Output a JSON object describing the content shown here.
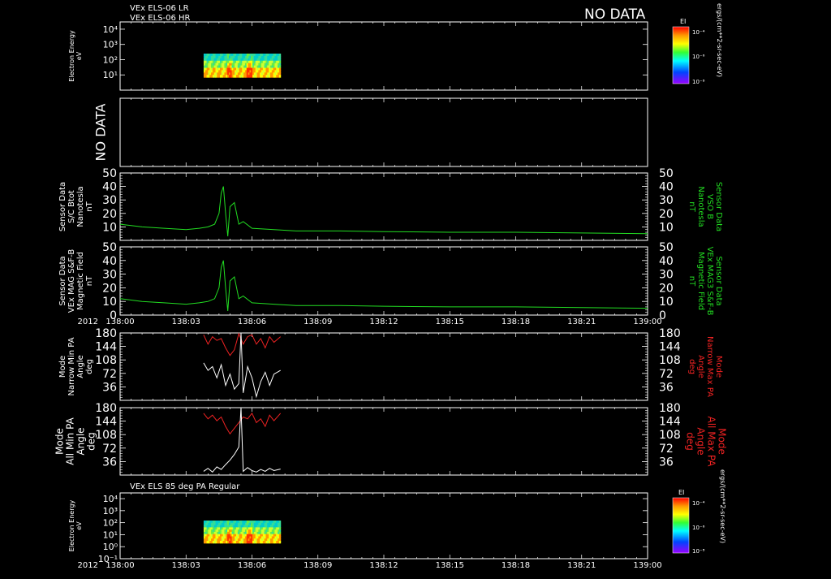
{
  "header": {
    "line1": "VEx ELS-06 LR",
    "line2": "VEx ELS-06 HR",
    "no_data": "NO DATA"
  },
  "colors": {
    "bg": "#000000",
    "fg": "#ffffff",
    "green": "#22dd22",
    "red": "#ee2222"
  },
  "colorbar_top": {
    "title": "EI",
    "ticks": [
      "10⁻⁴",
      "10⁻⁶",
      "10⁻⁸"
    ],
    "units": "ergs/(cm**2-sr-sec-eV)"
  },
  "colorbar_bottom": {
    "title": "EI",
    "ticks": [
      "10⁻⁴",
      "10⁻⁶",
      "10⁻⁸"
    ],
    "units": "ergs/(cm**2-sr-sec-eV)"
  },
  "section_label": "VEx ELS 85 deg PA Regular",
  "time_axis": {
    "year": "2012",
    "ticks": [
      "138:00",
      "138:03",
      "138:06",
      "138:09",
      "138:12",
      "138:15",
      "138:18",
      "138:21",
      "139:00"
    ]
  },
  "chart_data": [
    {
      "type": "heatmap",
      "panel": "els_lr_hr",
      "ylabel": "Electron Energy\neV",
      "yscale": "log",
      "yticks": [
        "10⁴",
        "10³",
        "10²",
        "10¹"
      ],
      "ylim": [
        1,
        30000
      ],
      "data_extent_minutes": [
        3.8,
        7.3
      ],
      "energy_extent_eV": [
        7,
        250
      ],
      "colorbar": "EI"
    },
    {
      "type": "line",
      "panel": "no_data_panel",
      "ylabel": "NO DATA"
    },
    {
      "type": "line",
      "panel": "sc_btot",
      "ylabel": "Sensor Data\nS/C Btot\nNanotesla\nnT",
      "ylabel_right": "Sensor Data\nVSO B\nNanotesla\nnT",
      "yticks": [
        10,
        20,
        30,
        40,
        50
      ],
      "ylim": [
        0,
        50
      ],
      "series": [
        {
          "color": "green",
          "x": [
            0,
            1,
            2,
            3,
            3.6,
            4,
            4.3,
            4.5,
            4.6,
            4.7,
            4.8,
            4.9,
            5.0,
            5.2,
            5.4,
            5.6,
            6,
            7,
            8,
            9,
            10,
            12,
            15,
            18,
            21,
            24
          ],
          "y": [
            12,
            10,
            9,
            8,
            9,
            10,
            12,
            20,
            35,
            40,
            20,
            3,
            25,
            28,
            12,
            14,
            9,
            8,
            7,
            7,
            7,
            6.5,
            6,
            6,
            5.5,
            5
          ]
        }
      ]
    },
    {
      "type": "line",
      "panel": "vex_mag",
      "ylabel": "Sensor Data\nVEx MAG S&F-B\nMagnetic Field\nnT",
      "ylabel_right": "Sensor Data\nVEx MAG3 S&F-B\nMagnetic Field\nnT",
      "yticks": [
        0,
        10,
        20,
        30,
        40,
        50
      ],
      "ylim": [
        0,
        50
      ],
      "series": [
        {
          "color": "green",
          "x": [
            0,
            1,
            2,
            3,
            3.6,
            4,
            4.3,
            4.5,
            4.6,
            4.7,
            4.8,
            4.9,
            5.0,
            5.2,
            5.4,
            5.6,
            6,
            7,
            8,
            9,
            10,
            12,
            15,
            18,
            21,
            24
          ],
          "y": [
            12,
            10,
            9,
            8,
            9,
            10,
            12,
            20,
            35,
            40,
            20,
            3,
            25,
            28,
            12,
            14,
            9,
            8,
            7,
            7,
            7,
            6.5,
            6,
            6,
            5.5,
            5
          ]
        }
      ]
    },
    {
      "type": "line",
      "panel": "narrow_pa",
      "ylabel": "Mode\nNarrow Min PA\nAngle\ndeg",
      "ylabel_right": "Mode\nNarrow Max PA\nAngle\ndeg",
      "yticks": [
        36,
        72,
        108,
        144,
        180
      ],
      "ylim": [
        0,
        180
      ],
      "series": [
        {
          "name": "Max PA",
          "color": "red",
          "x": [
            3.8,
            4.0,
            4.2,
            4.4,
            4.6,
            4.8,
            5.0,
            5.2,
            5.4,
            5.6,
            5.8,
            6.0,
            6.2,
            6.4,
            6.6,
            6.8,
            7.0,
            7.3
          ],
          "y": [
            175,
            150,
            170,
            160,
            165,
            140,
            120,
            135,
            178,
            150,
            170,
            175,
            150,
            165,
            140,
            170,
            155,
            170
          ]
        },
        {
          "name": "Min PA",
          "color": "white",
          "x": [
            3.8,
            4.0,
            4.2,
            4.4,
            4.6,
            4.8,
            5.0,
            5.2,
            5.4,
            5.5,
            5.6,
            5.8,
            6.0,
            6.2,
            6.4,
            6.6,
            6.8,
            7.0,
            7.3
          ],
          "y": [
            100,
            80,
            90,
            60,
            95,
            40,
            70,
            30,
            45,
            180,
            20,
            90,
            60,
            10,
            50,
            75,
            40,
            70,
            80
          ]
        }
      ]
    },
    {
      "type": "line",
      "panel": "all_pa",
      "ylabel": "Mode\nAll Min PA\nAngle\ndeg",
      "ylabel_right": "Mode\nAll Max PA\nAngle\ndeg",
      "yticks": [
        36,
        72,
        108,
        144,
        180
      ],
      "ylim": [
        0,
        180
      ],
      "series": [
        {
          "name": "Max PA",
          "color": "red",
          "x": [
            3.8,
            4.0,
            4.2,
            4.4,
            4.6,
            4.8,
            5.0,
            5.2,
            5.4,
            5.6,
            5.8,
            6.0,
            6.2,
            6.4,
            6.6,
            6.8,
            7.0,
            7.3
          ],
          "y": [
            165,
            150,
            160,
            145,
            155,
            130,
            110,
            125,
            140,
            155,
            150,
            165,
            140,
            150,
            130,
            160,
            145,
            165
          ]
        },
        {
          "name": "Min PA",
          "color": "white",
          "x": [
            3.8,
            4.0,
            4.2,
            4.4,
            4.6,
            4.8,
            5.0,
            5.2,
            5.4,
            5.5,
            5.6,
            5.8,
            6.0,
            6.2,
            6.4,
            6.6,
            6.8,
            7.0,
            7.3
          ],
          "y": [
            10,
            18,
            8,
            22,
            15,
            28,
            40,
            55,
            75,
            180,
            10,
            20,
            12,
            8,
            15,
            10,
            18,
            12,
            16
          ]
        }
      ]
    },
    {
      "type": "heatmap",
      "panel": "els_85",
      "ylabel": "Electron Energy\neV",
      "yscale": "log",
      "yticks": [
        "10⁴",
        "10³",
        "10²",
        "10¹",
        "10⁰",
        "10⁻¹"
      ],
      "ylim": [
        0.1,
        30000
      ],
      "data_extent_minutes": [
        3.8,
        7.3
      ],
      "energy_extent_eV": [
        2,
        150
      ],
      "colorbar": "EI"
    }
  ]
}
